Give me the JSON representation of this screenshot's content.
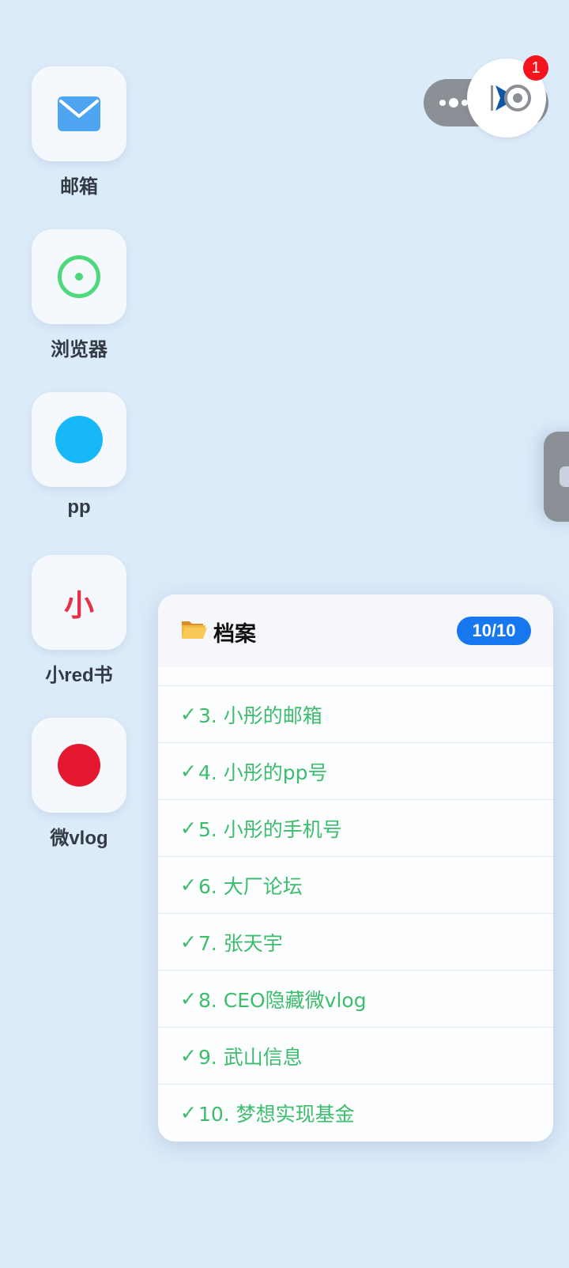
{
  "apps": [
    {
      "label": "邮箱",
      "icon": "mail-icon"
    },
    {
      "label": "浏览器",
      "icon": "browser-icon"
    },
    {
      "label": "pp",
      "icon": "pp-icon"
    },
    {
      "label": "小red书",
      "icon": "red-book-icon",
      "glyph": "小"
    },
    {
      "label": "微vlog",
      "icon": "vlog-icon"
    }
  ],
  "capsule": {
    "more_icon": "more-dots-icon",
    "float_icon": "floating-window-icon",
    "badge_count": "1"
  },
  "panel": {
    "title_icon": "open-folder-icon",
    "title": "档案",
    "count": "10/10",
    "check_mark": "✓",
    "items": [
      "3. 小彤的邮箱",
      "4. 小彤的pp号",
      "5. 小彤的手机号",
      "6. 大厂论坛",
      "7. 张天宇",
      "8. CEO隐藏微vlog",
      "9. 武山信息",
      "10. 梦想实现基金"
    ]
  },
  "colors": {
    "background": "#dcebf9",
    "check_green": "#3cbd6c",
    "count_badge": "#1677ee",
    "notification_red": "#f5141e"
  }
}
